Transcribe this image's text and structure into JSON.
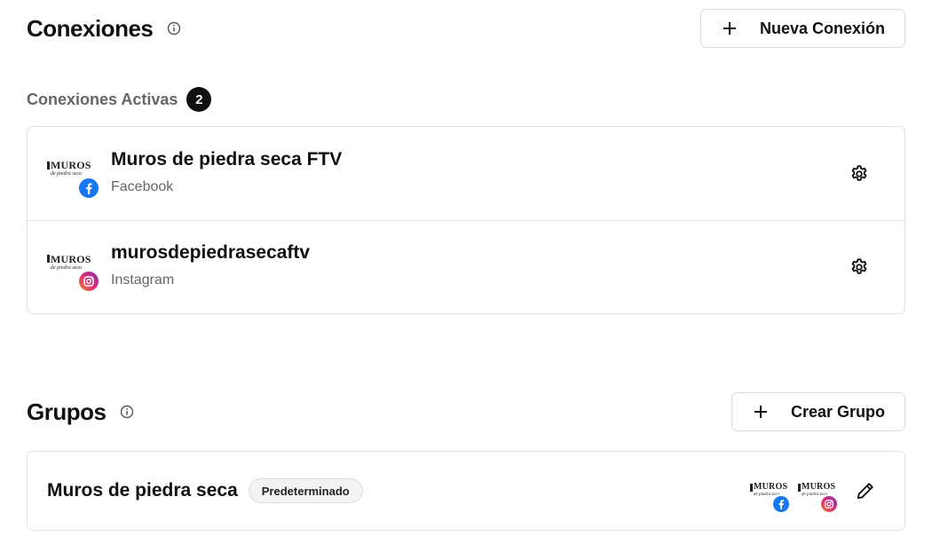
{
  "connections": {
    "title": "Conexiones",
    "new_button_label": "Nueva Conexión",
    "active_label": "Conexiones Activas",
    "active_count": "2",
    "items": [
      {
        "name": "Muros de piedra seca FTV",
        "network": "Facebook",
        "icon": "facebook-icon",
        "avatar_text": "MUROS",
        "avatar_sub": "de piedra seca"
      },
      {
        "name": "murosdepiedrasecaftv",
        "network": "Instagram",
        "icon": "instagram-icon",
        "avatar_text": "MUROS",
        "avatar_sub": "de piedra seca"
      }
    ]
  },
  "groups": {
    "title": "Grupos",
    "create_button_label": "Crear Grupo",
    "items": [
      {
        "name": "Muros de piedra seca",
        "badge": "Predeterminado",
        "avatar_text": "MUROS",
        "avatar_sub": "de piedra seca"
      }
    ]
  },
  "colors": {
    "facebook": "#1877f2",
    "instagram": "#dd2a7b",
    "badge_dark": "#111111"
  }
}
